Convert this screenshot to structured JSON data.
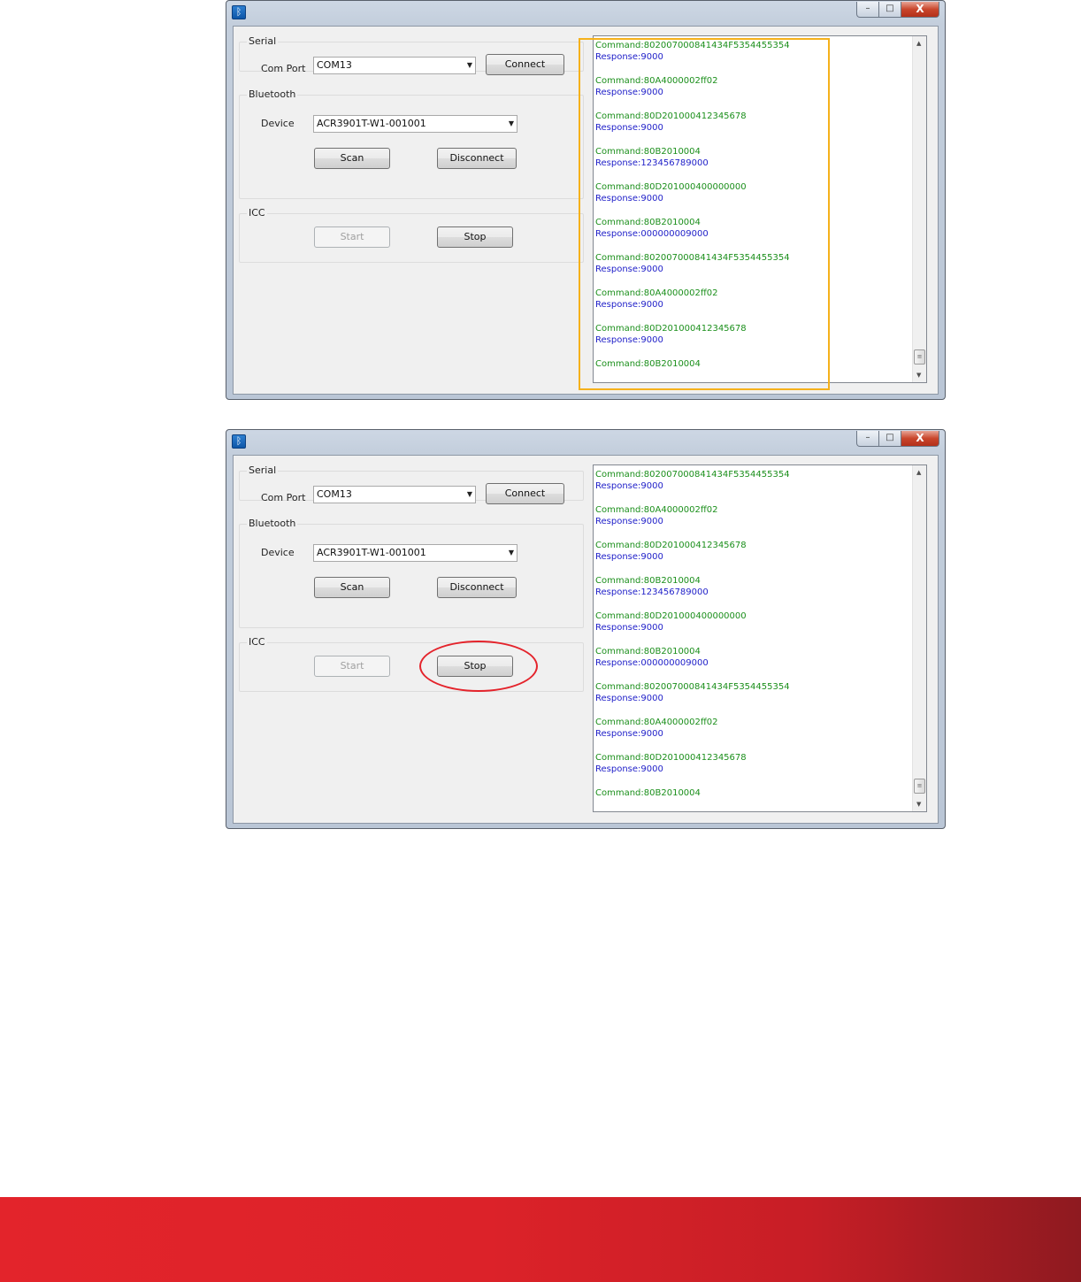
{
  "window": {
    "app_icon": "bluetooth-icon",
    "caption_buttons": {
      "minimize": "–",
      "maximize": "□",
      "close": "X"
    }
  },
  "serial": {
    "title": "Serial",
    "com_port_label": "Com Port",
    "com_port_value": "COM13",
    "connect_label": "Connect"
  },
  "bluetooth": {
    "title": "Bluetooth",
    "device_label": "Device",
    "device_value": "ACR3901T-W1-001001",
    "scan_label": "Scan",
    "disconnect_label": "Disconnect"
  },
  "icc": {
    "title": "ICC",
    "start_label": "Start",
    "stop_label": "Stop"
  },
  "log": {
    "entries": [
      {
        "command": "Command:802007000841434F5354455354",
        "response": "Response:9000"
      },
      {
        "command": "Command:80A4000002ff02",
        "response": "Response:9000"
      },
      {
        "command": "Command:80D201000412345678",
        "response": "Response:9000"
      },
      {
        "command": "Command:80B2010004",
        "response": "Response:123456789000"
      },
      {
        "command": "Command:80D201000400000000",
        "response": "Response:9000"
      },
      {
        "command": "Command:80B2010004",
        "response": "Response:000000009000"
      },
      {
        "command": "Command:802007000841434F5354455354",
        "response": "Response:9000"
      },
      {
        "command": "Command:80A4000002ff02",
        "response": "Response:9000"
      },
      {
        "command": "Command:80D201000412345678",
        "response": "Response:9000"
      },
      {
        "command": "Command:80B2010004",
        "response": ""
      }
    ]
  },
  "annotations": {
    "highlight_color": "#f5b11b",
    "circle_color": "#e4232b"
  },
  "footer": {
    "color": "#e3242b"
  }
}
